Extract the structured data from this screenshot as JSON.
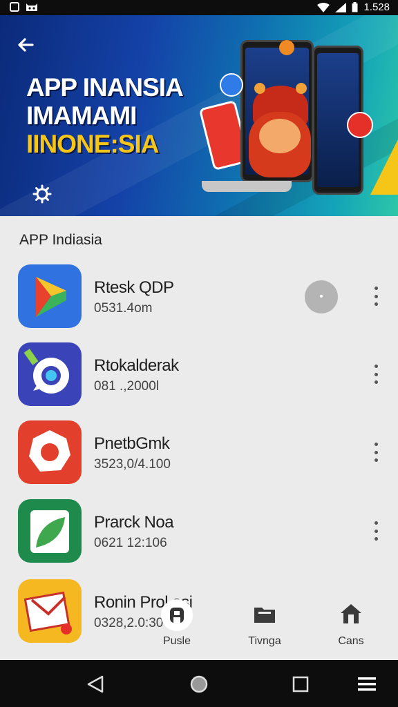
{
  "status_bar": {
    "time": "1.528",
    "left_icons": [
      "notification-icon",
      "cat-icon"
    ],
    "right_icons": [
      "wifi-icon",
      "signal-icon",
      "battery-icon"
    ]
  },
  "hero": {
    "title_lines": [
      "APP INANSIA",
      "IMAMAMI",
      "IINONE:SIA"
    ],
    "title_accent_color": "#f5c518",
    "back_icon": "back-arrow-icon",
    "settings_icon": "gear-icon"
  },
  "section": {
    "title": "APP Indiasia"
  },
  "apps": [
    {
      "name": "Rtesk QDP",
      "sub": "0531.4om",
      "icon": "play-store-icon",
      "color": "#2f72e0"
    },
    {
      "name": "Rtokalderak",
      "sub": "081 .,2000l",
      "icon": "chat-ring-icon",
      "color": "#3a44b8"
    },
    {
      "name": "PnetbGmk",
      "sub": "3523,0/4.100",
      "icon": "gear-badge-icon",
      "color": "#e2402c"
    },
    {
      "name": "Prarck Noa",
      "sub": "0621 12:106",
      "icon": "leaf-icon",
      "color": "#1e8a4c"
    },
    {
      "name": "Ronin Prol.asi",
      "sub": "0328,2.0:30",
      "icon": "mail-sale-icon",
      "color": "#f5b820"
    }
  ],
  "bottom_nav": [
    {
      "label": "Pusle",
      "icon": "lock-badge-icon"
    },
    {
      "label": "Tivnga",
      "icon": "folder-icon"
    },
    {
      "label": "Cans",
      "icon": "home-icon"
    }
  ],
  "system_nav": [
    "back-triangle-icon",
    "home-circle-icon",
    "recents-square-icon",
    "menu-icon"
  ]
}
